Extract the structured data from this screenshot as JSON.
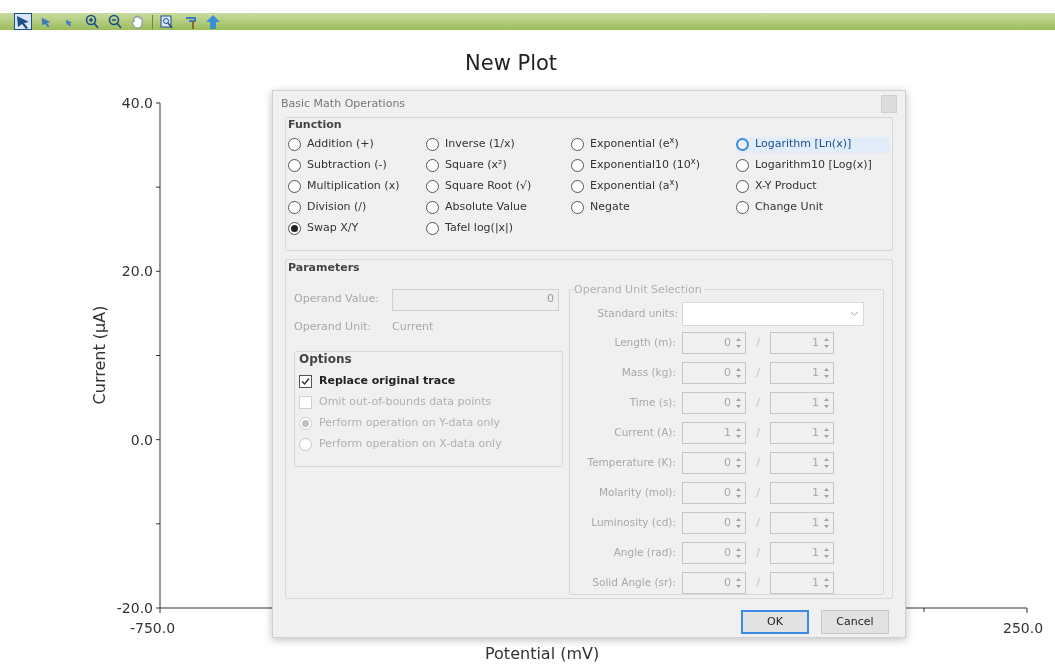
{
  "toolbar": {
    "tools": [
      {
        "selected": true
      },
      {
        "selected": false
      },
      {
        "selected": false
      },
      {
        "selected": false
      },
      {
        "selected": false
      },
      {
        "selected": false
      },
      {
        "selected": false
      },
      {
        "selected": false
      },
      {
        "selected": false
      }
    ]
  },
  "plot": {
    "title": "New Plot",
    "ylabel": "Current (µA)",
    "xlabel": "Potential (mV)",
    "yticks": [
      "40.0",
      "20.0",
      "0.0",
      "-20.0"
    ],
    "xticks": [
      "-750.0",
      "250.0"
    ]
  },
  "dialog": {
    "title": "Basic Math Operations",
    "function": {
      "label": "Function",
      "options": [
        {
          "label": "Addition (+)",
          "selected": false,
          "focused": false
        },
        {
          "label": "Inverse (1/x)",
          "selected": false,
          "focused": false
        },
        {
          "label": "Exponential (e$^{x}$)",
          "selected": false,
          "focused": false
        },
        {
          "label": "Logarithm [Ln(x)]",
          "selected": false,
          "focused": true
        },
        {
          "label": "Subtraction (-)",
          "selected": false,
          "focused": false
        },
        {
          "label": "Square (x²)",
          "selected": false,
          "focused": false
        },
        {
          "label": "Exponential10 (10$^{x}$)",
          "selected": false,
          "focused": false
        },
        {
          "label": "Logarithm10 [Log(x)]",
          "selected": false,
          "focused": false
        },
        {
          "label": "Multiplication (x)",
          "selected": false,
          "focused": false
        },
        {
          "label": "Square Root (√)",
          "selected": false,
          "focused": false
        },
        {
          "label": "Exponential (a$^{x}$)",
          "selected": false,
          "focused": false
        },
        {
          "label": "X-Y Product",
          "selected": false,
          "focused": false
        },
        {
          "label": "Division (/)",
          "selected": false,
          "focused": false
        },
        {
          "label": "Absolute Value",
          "selected": false,
          "focused": false
        },
        {
          "label": "Negate",
          "selected": false,
          "focused": false
        },
        {
          "label": "Change Unit",
          "selected": false,
          "focused": false
        },
        {
          "label": "Swap X/Y",
          "selected": true,
          "focused": false
        },
        {
          "label": "Tafel log(|x|)",
          "selected": false,
          "focused": false
        }
      ]
    },
    "parameters": {
      "label": "Parameters",
      "operand_value_label": "Operand Value:",
      "operand_value": "0",
      "operand_unit_label": "Operand Unit:",
      "operand_unit": "Current",
      "disabled": true,
      "options": {
        "label": "Options",
        "items": [
          {
            "kind": "checkbox",
            "label": "Replace original trace",
            "checked": true,
            "disabled": false
          },
          {
            "kind": "checkbox",
            "label": "Omit out-of-bounds data points",
            "checked": false,
            "disabled": true
          },
          {
            "kind": "radio",
            "label": "Perform operation on Y-data only",
            "selected": true,
            "disabled": true
          },
          {
            "kind": "radio",
            "label": "Perform operation on X-data only",
            "selected": false,
            "disabled": true
          }
        ]
      },
      "unit_selection": {
        "label": "Operand Unit Selection",
        "standard_units_label": "Standard units:",
        "separator": "/",
        "rows": [
          {
            "label": "Length (m):",
            "numerator": "0",
            "denominator": "1"
          },
          {
            "label": "Mass (kg):",
            "numerator": "0",
            "denominator": "1"
          },
          {
            "label": "Time (s):",
            "numerator": "0",
            "denominator": "1"
          },
          {
            "label": "Current (A):",
            "numerator": "1",
            "denominator": "1"
          },
          {
            "label": "Temperature (K):",
            "numerator": "0",
            "denominator": "1"
          },
          {
            "label": "Molarity (mol):",
            "numerator": "0",
            "denominator": "1"
          },
          {
            "label": "Luminosity (cd):",
            "numerator": "0",
            "denominator": "1"
          },
          {
            "label": "Angle (rad):",
            "numerator": "0",
            "denominator": "1"
          },
          {
            "label": "Solid Angle (sr):",
            "numerator": "0",
            "denominator": "1"
          }
        ]
      }
    },
    "buttons": [
      {
        "label": "OK",
        "default": true
      },
      {
        "label": "Cancel",
        "default": false
      }
    ]
  }
}
